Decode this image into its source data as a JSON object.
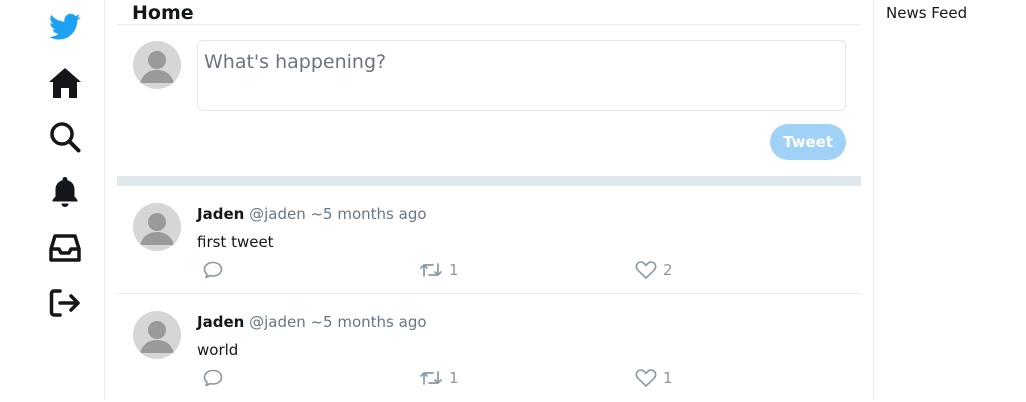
{
  "sidebar": {
    "icons": [
      "twitter-bird-icon",
      "home-icon",
      "search-icon",
      "bell-icon",
      "inbox-icon",
      "logout-icon"
    ],
    "brand_color": "#1da1f2"
  },
  "main": {
    "title": "Home",
    "composer": {
      "placeholder": "What's happening?",
      "tweet_label": "Tweet",
      "button_color": "#a0d2f7"
    },
    "tweets": [
      {
        "author": "Jaden",
        "handle": "@jaden",
        "time": "~5 months ago",
        "text": "first tweet",
        "replies": "",
        "retweets": "1",
        "likes": "2"
      },
      {
        "author": "Jaden",
        "handle": "@jaden",
        "time": "~5 months ago",
        "text": "world",
        "replies": "",
        "retweets": "1",
        "likes": "1"
      }
    ]
  },
  "rightbar": {
    "title": "News Feed"
  }
}
